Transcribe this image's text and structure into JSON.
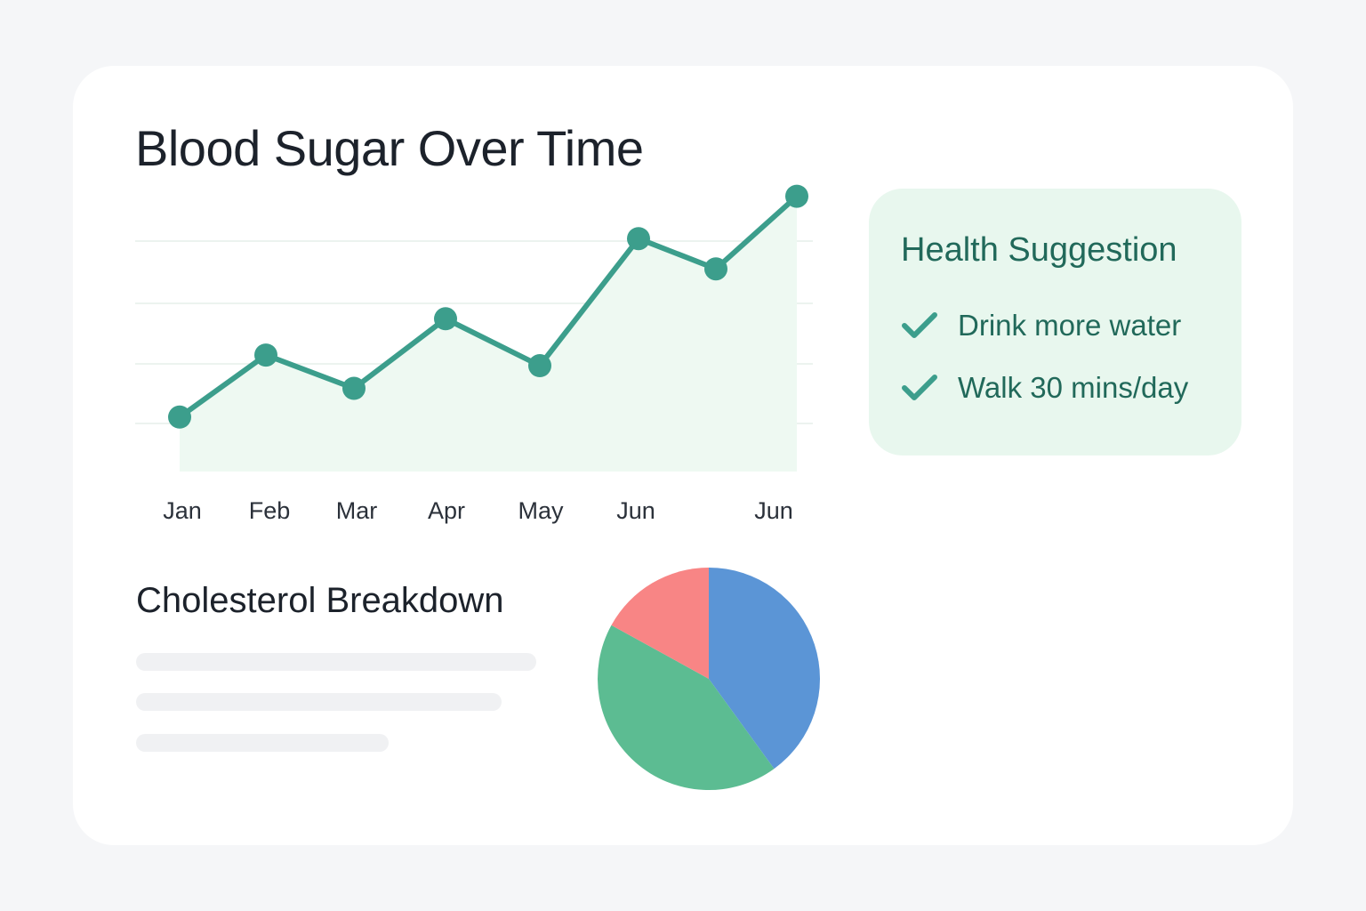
{
  "main": {
    "title": "Blood Sugar Over Time",
    "section_title": "Cholesterol Breakdown"
  },
  "suggestions": {
    "title": "Health Suggestion",
    "items": [
      {
        "icon": "check-icon",
        "label": "Drink more water"
      },
      {
        "icon": "check-icon",
        "label": "Walk 30 mins/day"
      }
    ]
  },
  "colors": {
    "line": "#3c9e8c",
    "area": "#eef9f2",
    "grid": "#ecf3ef",
    "pie_blue": "#5b95d6",
    "pie_green": "#5cbc92",
    "pie_red": "#f88585"
  },
  "chart_data": [
    {
      "type": "line",
      "title": "Blood Sugar Over Time",
      "categories": [
        "Jan",
        "Feb",
        "Mar",
        "Apr",
        "May",
        "Jun",
        "",
        "Jun"
      ],
      "values": [
        1.8,
        3.85,
        2.75,
        5.05,
        3.5,
        7.7,
        6.7,
        9.1
      ],
      "ylim": [
        0,
        10
      ],
      "grid": true,
      "area_fill": true
    },
    {
      "type": "pie",
      "title": "Cholesterol Breakdown",
      "slices": [
        {
          "color": "#5b95d6",
          "value": 40
        },
        {
          "color": "#5cbc92",
          "value": 43
        },
        {
          "color": "#f88585",
          "value": 17
        }
      ]
    }
  ]
}
